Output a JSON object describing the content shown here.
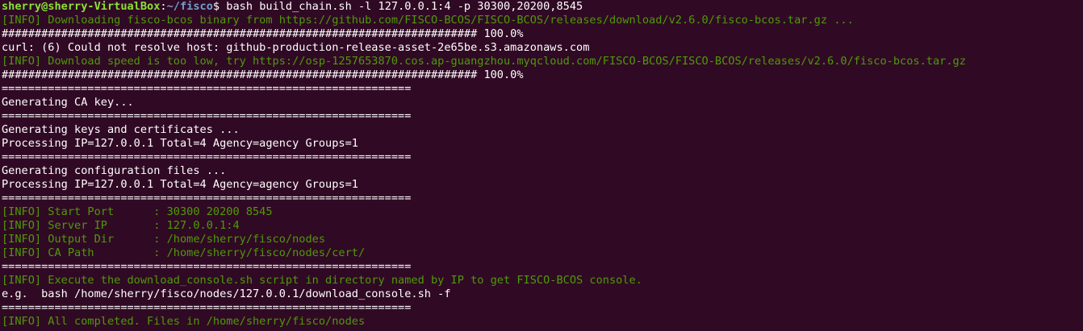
{
  "prompt": {
    "user_host": "sherry@sherry-VirtualBox",
    "separator": ":",
    "path": "~/fisco",
    "symbol": "$",
    "command": " bash build_chain.sh -l 127.0.0.1:4 -p 30300,20200,8545"
  },
  "lines": [
    {
      "text": "[INFO] Downloading fisco-bcos binary from https://github.com/FISCO-BCOS/FISCO-BCOS/releases/download/v2.6.0/fisco-bcos.tar.gz ...",
      "color": "green"
    },
    {
      "text": "######################################################################## 100.0%",
      "color": "white"
    },
    {
      "text": "curl: (6) Could not resolve host: github-production-release-asset-2e65be.s3.amazonaws.com",
      "color": "white"
    },
    {
      "text": "[INFO] Download speed is too low, try https://osp-1257653870.cos.ap-guangzhou.myqcloud.com/FISCO-BCOS/FISCO-BCOS/releases/v2.6.0/fisco-bcos.tar.gz",
      "color": "green"
    },
    {
      "text": "######################################################################## 100.0%",
      "color": "white"
    },
    {
      "text": "==============================================================",
      "color": "white"
    },
    {
      "text": "Generating CA key...",
      "color": "white"
    },
    {
      "text": "==============================================================",
      "color": "white"
    },
    {
      "text": "Generating keys and certificates ...",
      "color": "white"
    },
    {
      "text": "Processing IP=127.0.0.1 Total=4 Agency=agency Groups=1",
      "color": "white"
    },
    {
      "text": "==============================================================",
      "color": "white"
    },
    {
      "text": "Generating configuration files ...",
      "color": "white"
    },
    {
      "text": "Processing IP=127.0.0.1 Total=4 Agency=agency Groups=1",
      "color": "white"
    },
    {
      "text": "==============================================================",
      "color": "white"
    },
    {
      "text": "[INFO] Start Port      : 30300 20200 8545",
      "color": "green"
    },
    {
      "text": "[INFO] Server IP       : 127.0.0.1:4",
      "color": "green"
    },
    {
      "text": "[INFO] Output Dir      : /home/sherry/fisco/nodes",
      "color": "green"
    },
    {
      "text": "[INFO] CA Path         : /home/sherry/fisco/nodes/cert/",
      "color": "green"
    },
    {
      "text": "==============================================================",
      "color": "white"
    },
    {
      "text": "[INFO] Execute the download_console.sh script in directory named by IP to get FISCO-BCOS console.",
      "color": "green"
    },
    {
      "text": "e.g.  bash /home/sherry/fisco/nodes/127.0.0.1/download_console.sh -f",
      "color": "white"
    },
    {
      "text": "==============================================================",
      "color": "white"
    },
    {
      "text": "[INFO] All completed. Files in /home/sherry/fisco/nodes",
      "color": "green"
    }
  ],
  "colors": {
    "background": "#300a24",
    "green": "#4e9a06",
    "prompt_user": "#8ae234",
    "prompt_path": "#729fcf",
    "white": "#ffffff"
  }
}
